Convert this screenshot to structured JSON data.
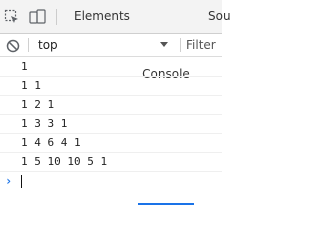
{
  "toolbar": {
    "inspect_icon": "inspect-element-icon",
    "device_icon": "device-toolbar-icon",
    "tabs": [
      {
        "label": "Elements"
      },
      {
        "label": "Console"
      },
      {
        "label": "Sou"
      }
    ]
  },
  "filterbar": {
    "clear_icon": "clear-console-icon",
    "context": "top",
    "filter_placeholder": "Filter"
  },
  "console": {
    "lines": [
      "1",
      "1 1",
      "1 2 1",
      "1 3 3 1",
      "1 4 6 4 1",
      "1 5 10 10 5 1"
    ],
    "prompt_glyph": "›"
  },
  "colors": {
    "accent": "#1a73e8",
    "tabbar_bg": "#f3f3f3",
    "text": "#222222"
  }
}
